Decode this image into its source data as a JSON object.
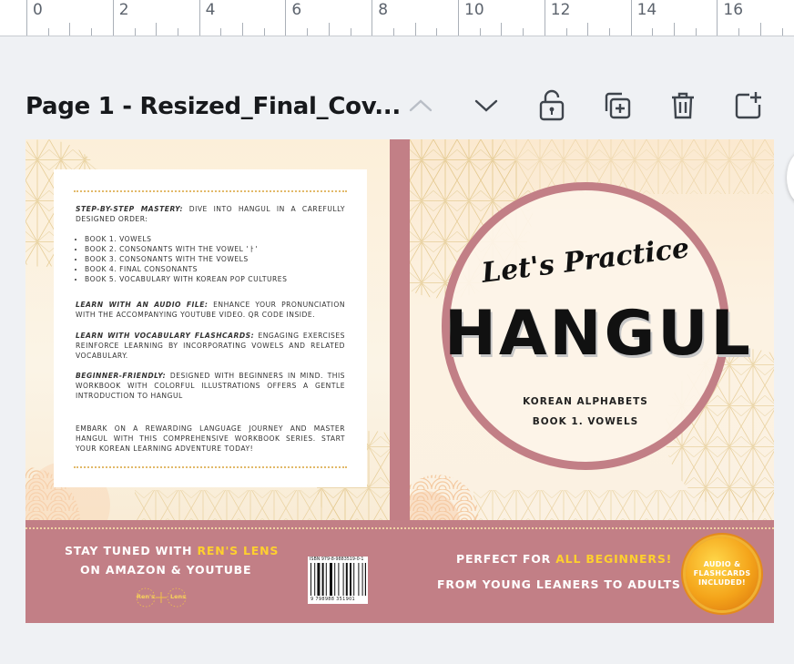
{
  "ruler": {
    "labels": [
      "0",
      "2",
      "4",
      "6",
      "8",
      "10",
      "12",
      "14",
      "16"
    ]
  },
  "page_bar": {
    "title": "Page 1 - Resized_Final_Cov...",
    "buttons": [
      "move-up",
      "move-down",
      "unlock",
      "duplicate-page",
      "delete-page",
      "add-page"
    ]
  },
  "back_cover": {
    "mastery_title": "STEP-BY-STEP MASTERY:",
    "mastery_text": "DIVE INTO HANGUL IN A CAREFULLY DESIGNED ORDER:",
    "books": [
      "BOOK 1. VOWELS",
      "BOOK 2. CONSONANTS WITH THE VOWEL 'ㅏ'",
      "BOOK 3. CONSONANTS WITH THE VOWELS",
      "BOOK 4. FINAL CONSONANTS",
      "BOOK 5. VOCABULARY WITH KOREAN POP CULTURES"
    ],
    "audio_title": "LEARN WITH AN AUDIO FILE:",
    "audio_text": "ENHANCE YOUR PRONUNCIATION WITH THE ACCOMPANYING YOUTUBE VIDEO. QR CODE INSIDE.",
    "flash_title": "LEARN WITH VOCABULARY FLASHCARDS:",
    "flash_text": "ENGAGING EXERCISES REINFORCE LEARNING BY INCORPORATING VOWELS AND RELATED VOCABULARY.",
    "beginner_title": "BEGINNER-FRIENDLY:",
    "beginner_text": "DESIGNED WITH BEGINNERS IN MIND. THIS WORKBOOK WITH COLORFUL ILLUSTRATIONS OFFERS A GENTLE INTRODUCTION TO HANGUL",
    "closing": "EMBARK ON A REWARDING LANGUAGE JOURNEY AND MASTER HANGUL WITH THIS COMPREHENSIVE WORKBOOK SERIES. START YOUR KOREAN LEARNING ADVENTURE TODAY!"
  },
  "front_cover": {
    "script_title": "Let's Practice",
    "main_title": "HANGUL",
    "subtitle1": "KOREAN ALPHABETS",
    "subtitle2": "BOOK 1. VOWELS"
  },
  "bottom_strip": {
    "stay_tuned": "STAY TUNED WITH",
    "brand": "REN'S LENS",
    "platforms": "ON AMAZON & YOUTUBE",
    "logo_left": "Ren's",
    "logo_right": "Lens",
    "isbn": "ISBN 979-8-9883519-0-1",
    "barcode_digits": "9 798988 351901",
    "perfect_for": "PERFECT FOR",
    "all_beginners": "ALL BEGINNERS!",
    "from_young": "FROM YOUNG LEANERS TO ADULTS",
    "badge_lines": [
      "AUDIO &",
      "FLASHCARDS",
      "INCLUDED!"
    ]
  },
  "colors": {
    "rose": "#c27f86",
    "cream": "#fdf4e2",
    "accent_yellow": "#ffd02e",
    "gold": "#e2b96a"
  }
}
